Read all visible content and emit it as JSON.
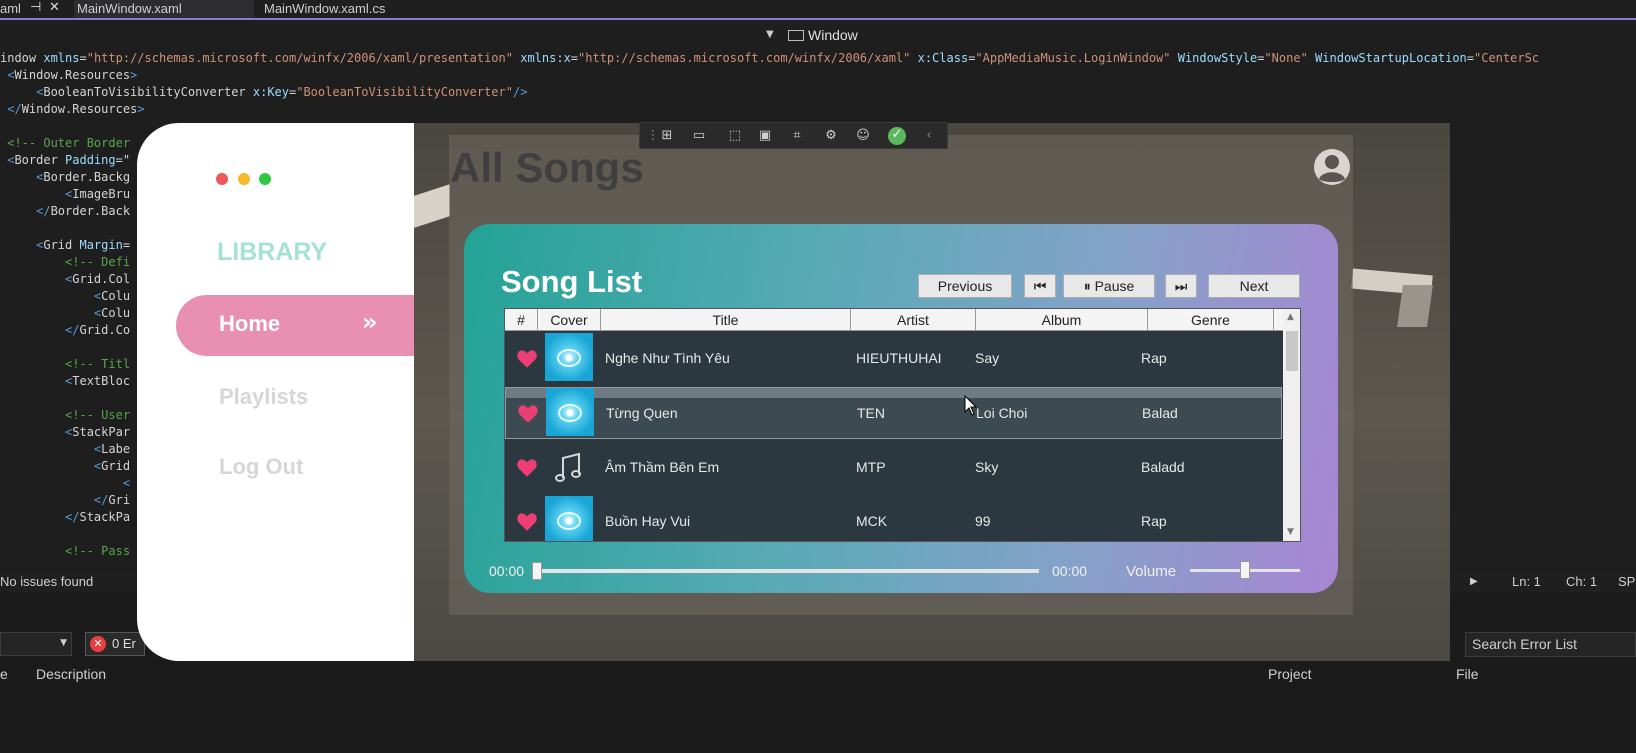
{
  "ide": {
    "tabs": [
      {
        "label": "MainWindow.xaml",
        "active": true
      },
      {
        "label": "MainWindow.xaml.cs",
        "active": false
      }
    ],
    "pin_glyph": "⊣",
    "close_glyph": "✕",
    "edge_fragment": "aml",
    "element_selector": "Window",
    "code_lines": [
      {
        "parts": [
          [
            "tx",
            "indow "
          ],
          [
            "at",
            "xmlns"
          ],
          [
            "tx",
            "="
          ],
          [
            "st",
            "\"http://schemas.microsoft.com/winfx/2006/xaml/presentation\""
          ],
          [
            "tx",
            " "
          ],
          [
            "at",
            "xmlns:x"
          ],
          [
            "tx",
            "="
          ],
          [
            "st",
            "\"http://schemas.microsoft.com/winfx/2006/xaml\""
          ],
          [
            "tx",
            " "
          ],
          [
            "at",
            "x:Class"
          ],
          [
            "tx",
            "="
          ],
          [
            "st",
            "\"AppMediaMusic.LoginWindow\""
          ],
          [
            "tx",
            " "
          ],
          [
            "at",
            "WindowStyle"
          ],
          [
            "tx",
            "="
          ],
          [
            "st",
            "\"None\""
          ],
          [
            "tx",
            " "
          ],
          [
            "at",
            "WindowStartupLocation"
          ],
          [
            "tx",
            "="
          ],
          [
            "st",
            "\"CenterSc"
          ]
        ]
      },
      {
        "parts": [
          [
            "tg",
            " <"
          ],
          [
            "tx",
            "Window.Resources"
          ],
          [
            "tg",
            ">"
          ]
        ]
      },
      {
        "parts": [
          [
            "tg",
            "     <"
          ],
          [
            "tx",
            "BooleanToVisibilityConverter "
          ],
          [
            "at",
            "x:Key"
          ],
          [
            "tx",
            "="
          ],
          [
            "st",
            "\"BooleanToVisibilityConverter\""
          ],
          [
            "tg",
            "/>"
          ]
        ]
      },
      {
        "parts": [
          [
            "tg",
            " </"
          ],
          [
            "tx",
            "Window.Resources"
          ],
          [
            "tg",
            ">"
          ]
        ]
      },
      {
        "parts": []
      },
      {
        "parts": [
          [
            "cm",
            " <!-- Outer Border"
          ]
        ]
      },
      {
        "parts": [
          [
            "tg",
            " <"
          ],
          [
            "tx",
            "Border "
          ],
          [
            "at",
            "Padding"
          ],
          [
            "tx",
            "=\""
          ]
        ]
      },
      {
        "parts": [
          [
            "tg",
            "     <"
          ],
          [
            "tx",
            "Border.Backg"
          ]
        ]
      },
      {
        "parts": [
          [
            "tg",
            "         <"
          ],
          [
            "tx",
            "ImageBru"
          ]
        ]
      },
      {
        "parts": [
          [
            "tg",
            "     </"
          ],
          [
            "tx",
            "Border.Back"
          ]
        ]
      },
      {
        "parts": []
      },
      {
        "parts": [
          [
            "tg",
            "     <"
          ],
          [
            "tx",
            "Grid "
          ],
          [
            "at",
            "Margin"
          ],
          [
            "tx",
            "="
          ]
        ]
      },
      {
        "parts": [
          [
            "cm",
            "         <!-- Defi"
          ]
        ]
      },
      {
        "parts": [
          [
            "tg",
            "         <"
          ],
          [
            "tx",
            "Grid.Col"
          ]
        ]
      },
      {
        "parts": [
          [
            "tg",
            "             <"
          ],
          [
            "tx",
            "Colu"
          ]
        ]
      },
      {
        "parts": [
          [
            "tg",
            "             <"
          ],
          [
            "tx",
            "Colu"
          ]
        ]
      },
      {
        "parts": [
          [
            "tg",
            "         </"
          ],
          [
            "tx",
            "Grid.Co"
          ]
        ]
      },
      {
        "parts": []
      },
      {
        "parts": [
          [
            "cm",
            "         <!-- Titl"
          ]
        ]
      },
      {
        "parts": [
          [
            "tg",
            "         <"
          ],
          [
            "tx",
            "TextBloc"
          ]
        ]
      },
      {
        "parts": []
      },
      {
        "parts": [
          [
            "cm",
            "         <!-- User"
          ]
        ]
      },
      {
        "parts": [
          [
            "tg",
            "         <"
          ],
          [
            "tx",
            "StackPar"
          ]
        ]
      },
      {
        "parts": [
          [
            "tg",
            "             <"
          ],
          [
            "tx",
            "Labe"
          ]
        ]
      },
      {
        "parts": [
          [
            "tg",
            "             <"
          ],
          [
            "tx",
            "Grid"
          ]
        ]
      },
      {
        "parts": [
          [
            "tg",
            "                 <"
          ]
        ]
      },
      {
        "parts": [
          [
            "tg",
            "             </"
          ],
          [
            "tx",
            "Gri"
          ]
        ]
      },
      {
        "parts": [
          [
            "tg",
            "         </"
          ],
          [
            "tx",
            "StackPa"
          ]
        ]
      },
      {
        "parts": []
      },
      {
        "parts": [
          [
            "cm",
            "         <!-- Pass"
          ]
        ]
      }
    ],
    "status": {
      "issues": "No issues found",
      "ln": "Ln: 1",
      "ch": "Ch: 1",
      "enc": "SP"
    },
    "error_list": {
      "errors_label": "0 Er",
      "search_placeholder": "Search Error List",
      "columns": [
        "e",
        "Description",
        "Project",
        "File"
      ]
    }
  },
  "app": {
    "traffic_lights": [
      "#f0575b",
      "#f5b82e",
      "#2fc840"
    ],
    "library_label": "LIBRARY",
    "nav": [
      {
        "label": "Home",
        "active": true,
        "chevron": "»"
      },
      {
        "label": "Playlists",
        "active": false
      },
      {
        "label": "Log Out",
        "active": false
      }
    ],
    "page_title": "All Songs",
    "song_list_title": "Song List",
    "player_buttons": {
      "previous": "Previous",
      "prev_icon": "⏮",
      "pause": "Pause",
      "pause_icon": "⏸",
      "next_icon": "⏭",
      "next": "Next"
    },
    "table": {
      "columns": [
        "#",
        "Cover",
        "Title",
        "Artist",
        "Album",
        "Genre"
      ],
      "rows": [
        {
          "title": "Nghe Như Tình Yêu",
          "artist": "HIEUTHUHAI",
          "album": "Say",
          "genre": "Rap",
          "cover": "disc",
          "favorite": true,
          "selected": false
        },
        {
          "title": "Từng Quen",
          "artist": "TEN",
          "album": "Loi Choi",
          "genre": "Balad",
          "cover": "disc",
          "favorite": true,
          "selected": true
        },
        {
          "title": "Âm Thầm Bên Em",
          "artist": "MTP",
          "album": "Sky",
          "genre": "Baladd",
          "cover": "note",
          "favorite": true,
          "selected": false
        },
        {
          "title": "Buồn Hay Vui",
          "artist": "MCK",
          "album": "99",
          "genre": "Rap",
          "cover": "disc",
          "favorite": true,
          "selected": false
        }
      ]
    },
    "player": {
      "current_time": "00:00",
      "total_time": "00:00",
      "volume_label": "Volume",
      "progress": 0.0,
      "volume": 0.5
    },
    "colors": {
      "accent_pink": "#e98fb2",
      "library_green": "#a6e3cf",
      "heart": "#ee3f74"
    }
  }
}
